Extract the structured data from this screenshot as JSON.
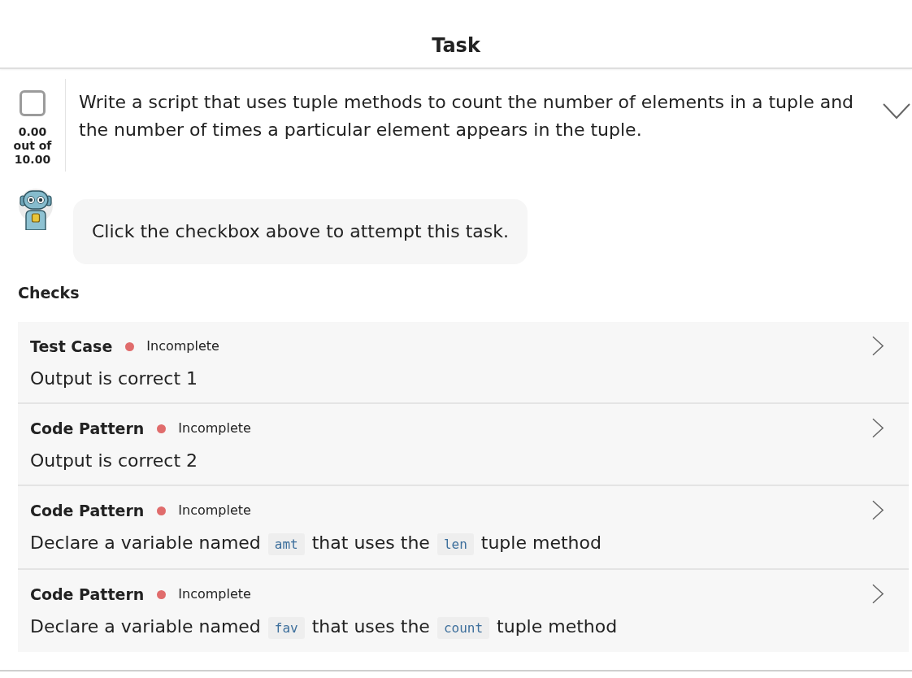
{
  "header": {
    "title": "Task"
  },
  "task": {
    "checked": false,
    "score": "0.00",
    "score_label": "out of",
    "max_score": "10.00",
    "prompt": "Write a script that uses tuple methods to count the number of elements in a tuple and the number of times a particular element appears in the tuple.",
    "expanded": false
  },
  "assistant": {
    "message": "Click the checkbox above to attempt this task."
  },
  "checks": {
    "title": "Checks",
    "items": [
      {
        "type": "Test Case",
        "status": "Incomplete",
        "color": "#e06c6c",
        "expanded": false,
        "description": [
          {
            "kind": "text",
            "text": "Output is correct 1"
          }
        ]
      },
      {
        "type": "Code Pattern",
        "status": "Incomplete",
        "color": "#e06c6c",
        "expanded": false,
        "description": [
          {
            "kind": "text",
            "text": "Output is correct 2"
          }
        ]
      },
      {
        "type": "Code Pattern",
        "status": "Incomplete",
        "color": "#e06c6c",
        "expanded": false,
        "description": [
          {
            "kind": "text",
            "text": "Declare a variable named "
          },
          {
            "kind": "code",
            "text": "amt"
          },
          {
            "kind": "text",
            "text": " that uses the "
          },
          {
            "kind": "code",
            "text": "len"
          },
          {
            "kind": "text",
            "text": " tuple method"
          }
        ]
      },
      {
        "type": "Code Pattern",
        "status": "Incomplete",
        "color": "#e06c6c",
        "expanded": false,
        "description": [
          {
            "kind": "text",
            "text": "Declare a variable named "
          },
          {
            "kind": "code",
            "text": "fav"
          },
          {
            "kind": "text",
            "text": " that uses the "
          },
          {
            "kind": "code",
            "text": "count"
          },
          {
            "kind": "text",
            "text": " tuple method"
          }
        ]
      }
    ]
  }
}
